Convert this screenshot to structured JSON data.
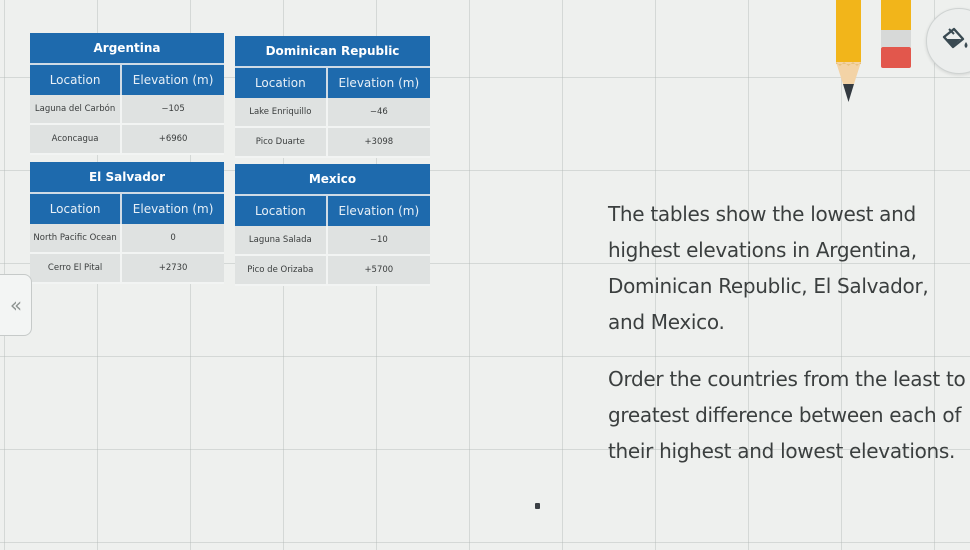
{
  "tables": [
    {
      "title": "Argentina",
      "headers": [
        "Location",
        "Elevation (m)"
      ],
      "rows": [
        [
          "Laguna del Carbón",
          "−105"
        ],
        [
          "Aconcagua",
          "+6960"
        ]
      ]
    },
    {
      "title": "Dominican Republic",
      "headers": [
        "Location",
        "Elevation (m)"
      ],
      "rows": [
        [
          "Lake Enriquillo",
          "−46"
        ],
        [
          "Pico Duarte",
          "+3098"
        ]
      ]
    },
    {
      "title": "El Salvador",
      "headers": [
        "Location",
        "Elevation (m)"
      ],
      "rows": [
        [
          "North Pacific Ocean",
          "0"
        ],
        [
          "Cerro El Pital",
          "+2730"
        ]
      ]
    },
    {
      "title": "Mexico",
      "headers": [
        "Location",
        "Elevation (m)"
      ],
      "rows": [
        [
          "Laguna Salada",
          "−10"
        ],
        [
          "Pico de Orizaba",
          "+5700"
        ]
      ]
    }
  ],
  "prompt": {
    "intro": "The tables show the lowest and highest elevations in Argentina, Dominican Republic, El Salvador, and Mexico.",
    "instruction": "Order the countries from the least to greatest difference between each of their highest and lowest elevations."
  },
  "navigation": {
    "back_label": "«"
  },
  "tools": {
    "pencil": "pencil-tool",
    "eraser": "eraser-tool",
    "fill": "paint-bucket-tool"
  },
  "colors": {
    "table_header": "#1e6aad",
    "table_cell": "#dfe2e1",
    "pencil": "#f2b51a",
    "eraser": "#e2574c",
    "text": "#3b3f3f"
  }
}
